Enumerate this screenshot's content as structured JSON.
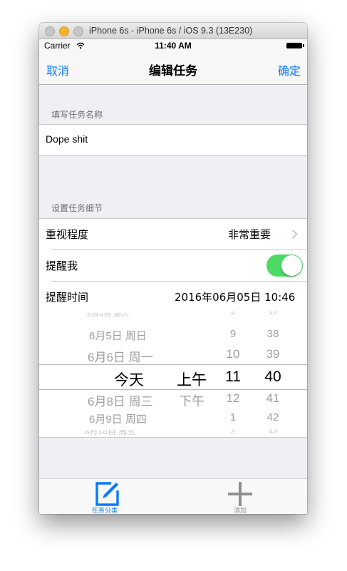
{
  "window": {
    "title": "iPhone 6s - iPhone 6s / iOS 9.3 (13E230)"
  },
  "status_bar": {
    "carrier": "Carrier",
    "time": "11:40 AM"
  },
  "nav": {
    "cancel": "取消",
    "title": "编辑任务",
    "confirm": "确定"
  },
  "section_name": {
    "header": "填写任务名称",
    "task_name": "Dope shit"
  },
  "section_detail": {
    "header": "设置任务细节",
    "importance_label": "重视程度",
    "importance_value": "非常重要",
    "remind_label": "提醒我",
    "remind_on": true,
    "remind_time_label": "提醒时间",
    "remind_time_value": "2016年06月05日 10:46"
  },
  "picker": {
    "date": [
      "6月4日 周六",
      "6月5日 周日",
      "6月6日 周一",
      "今天",
      "6月8日 周三",
      "6月9日 周四",
      "6月10日 周五"
    ],
    "ampm": [
      "上午",
      "下午"
    ],
    "hour": [
      "8",
      "9",
      "10",
      "11",
      "12",
      "1",
      "2"
    ],
    "minute": [
      "37",
      "38",
      "39",
      "40",
      "41",
      "42",
      "43"
    ],
    "selected_index": 3
  },
  "tab_bar": {
    "tabs": [
      {
        "label": "任务分类",
        "active": true
      },
      {
        "label": "添加",
        "active": false
      }
    ]
  },
  "colors": {
    "accent": "#0a7aff",
    "toggle_on": "#4cd964",
    "background": "#efeff4"
  }
}
